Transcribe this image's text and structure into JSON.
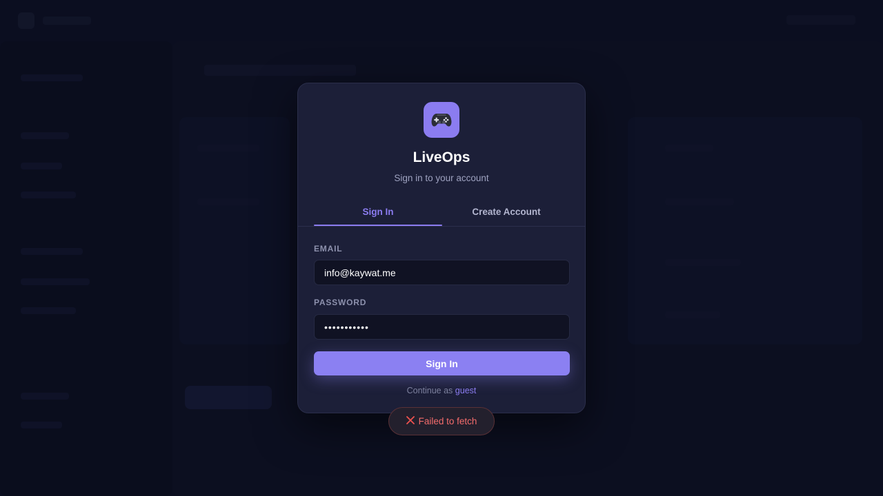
{
  "app": {
    "title": "LiveOps",
    "subtitle": "Sign in to your account",
    "icon": "gamepad-icon"
  },
  "tabs": [
    {
      "label": "Sign In",
      "active": true
    },
    {
      "label": "Create Account",
      "active": false
    }
  ],
  "form": {
    "email_label": "EMAIL",
    "email_value": "info@kaywat.me",
    "password_label": "PASSWORD",
    "password_value": "•••••••••••",
    "submit_label": "Sign In"
  },
  "guest": {
    "prefix": "Continue as",
    "link": "guest"
  },
  "toast": {
    "icon": "close-icon",
    "message": "Failed to fetch",
    "color": "#f46c6c"
  },
  "colors": {
    "accent": "#8b7cf0",
    "background": "#0d1024",
    "card": "#1c1f38",
    "error": "#f46c6c"
  }
}
